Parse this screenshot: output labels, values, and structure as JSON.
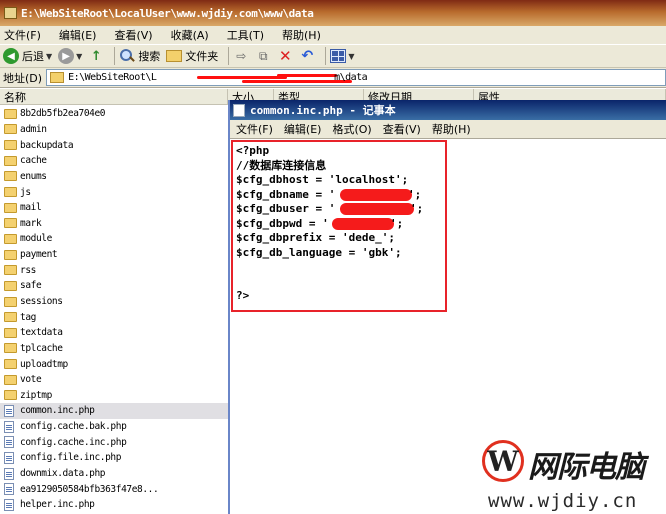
{
  "explorer": {
    "title": "E:\\WebSiteRoot\\LocalUser\\www.wjdiy.com\\www\\data",
    "menu": [
      "文件(F)",
      "编辑(E)",
      "查看(V)",
      "收藏(A)",
      "工具(T)",
      "帮助(H)"
    ],
    "toolbar": {
      "back_label": "后退",
      "search_label": "搜索",
      "folders_label": "文件夹"
    },
    "address": {
      "label": "地址(D)",
      "value": "E:\\WebSiteRoot\\L",
      "value_tail": "m\\data"
    },
    "columns": [
      "名称",
      "大小",
      "类型",
      "修改日期",
      "属性"
    ],
    "files": [
      {
        "name": "8b2db5fb2ea704e0",
        "kind": "folder"
      },
      {
        "name": "admin",
        "kind": "folder"
      },
      {
        "name": "backupdata",
        "kind": "folder"
      },
      {
        "name": "cache",
        "kind": "folder"
      },
      {
        "name": "enums",
        "kind": "folder"
      },
      {
        "name": "js",
        "kind": "folder"
      },
      {
        "name": "mail",
        "kind": "folder"
      },
      {
        "name": "mark",
        "kind": "folder"
      },
      {
        "name": "module",
        "kind": "folder"
      },
      {
        "name": "payment",
        "kind": "folder"
      },
      {
        "name": "rss",
        "kind": "folder"
      },
      {
        "name": "safe",
        "kind": "folder"
      },
      {
        "name": "sessions",
        "kind": "folder"
      },
      {
        "name": "tag",
        "kind": "folder"
      },
      {
        "name": "textdata",
        "kind": "folder"
      },
      {
        "name": "tplcache",
        "kind": "folder"
      },
      {
        "name": "uploadtmp",
        "kind": "folder"
      },
      {
        "name": "vote",
        "kind": "folder"
      },
      {
        "name": "ziptmp",
        "kind": "folder"
      },
      {
        "name": "common.inc.php",
        "kind": "file",
        "selected": true
      },
      {
        "name": "config.cache.bak.php",
        "kind": "file"
      },
      {
        "name": "config.cache.inc.php",
        "kind": "file"
      },
      {
        "name": "config.file.inc.php",
        "kind": "file"
      },
      {
        "name": "downmix.data.php",
        "kind": "file"
      },
      {
        "name": "ea9129050584bfb363f47e8...",
        "kind": "file"
      },
      {
        "name": "helper.inc.php",
        "kind": "file"
      }
    ]
  },
  "notepad": {
    "title": "common.inc.php - 记事本",
    "menu": [
      "文件(F)",
      "编辑(E)",
      "格式(O)",
      "查看(V)",
      "帮助(H)"
    ],
    "code": [
      "<?php",
      "//数据库连接信息",
      "$cfg_dbhost = 'localhost';",
      "$cfg_dbname = '",
      "$cfg_dbuser = '",
      "$cfg_dbpwd = '",
      "$cfg_dbprefix = 'dede_';",
      "$cfg_db_language = 'gbk';",
      "",
      "",
      "?>"
    ],
    "code_tails": [
      "",
      "",
      "",
      "';",
      "';",
      "';",
      "",
      "",
      "",
      "",
      ""
    ]
  },
  "watermark": {
    "logo_letter": "W",
    "brand": "网际电脑",
    "url": "www.wjdiy.cn"
  },
  "colors": {
    "highlight_box": "#e8232a",
    "redaction": "#f51b1b",
    "title_bar": "#7f2a14",
    "notepad_title": "#0a246a"
  }
}
